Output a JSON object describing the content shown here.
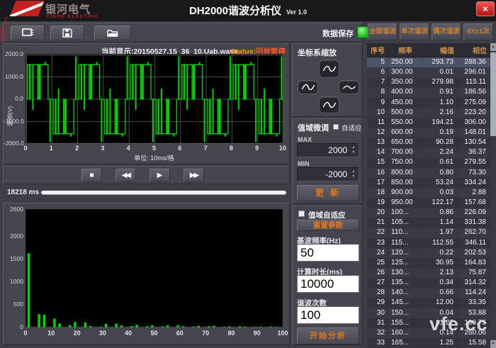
{
  "header": {
    "logo_cn": "银河电气",
    "logo_en": "YINHE ELECTRIC",
    "logo_vertical": "YINHE ELECTRIC",
    "title": "DH2000谐波分析仪",
    "version": "Ver 1.0",
    "close": "×"
  },
  "toolbar": {
    "save_label": "数据保存"
  },
  "wave_panel": {
    "current_label": "当前显示:20150527.15_36_10.Uab.wave",
    "status_key": "Status:",
    "status_value": "回放暂停",
    "y_axis_label": "幅值(V)",
    "unit_label": "单位: 10ms/格",
    "y_tick_labels": [
      "2000.0",
      "1000.0",
      "0.0",
      "-1000.0",
      "-2000.0"
    ],
    "x_tick_labels": [
      "0",
      "1",
      "2",
      "3",
      "4",
      "5",
      "6",
      "7",
      "8",
      "9",
      "10"
    ]
  },
  "playback": {
    "stop": "■",
    "rewind": "◀◀",
    "play": "▶",
    "forward": "▶▶",
    "time_label": "18218 ms"
  },
  "spectrum_panel": {
    "y_tick_labels": [
      "2600",
      "2000",
      "1500",
      "1000",
      "500",
      "0"
    ],
    "y_tick_values": [
      2600,
      2000,
      1500,
      1000,
      500,
      0
    ],
    "x_tick_labels": [
      "0",
      "10",
      "20",
      "30",
      "40",
      "50",
      "60",
      "70",
      "80",
      "90",
      "100"
    ]
  },
  "zoom_panel": {
    "title": "坐标系缩放"
  },
  "range_panel": {
    "title": "值域微调",
    "auto_label": "自适应",
    "max_label": "MAX",
    "max_value": "2000",
    "min_label": "MIN",
    "min_value": "-2000",
    "update_label": "更 新"
  },
  "analysis_panel": {
    "auto_label": "值域自适应",
    "reset_label": "重置参数",
    "freq_label": "基波频率(Hz)",
    "freq_value": "50",
    "duration_label": "计算时长(ms)",
    "duration_value": "10000",
    "count_label": "谐波次数",
    "count_value": "100",
    "start_label": "开始分析"
  },
  "tabs": [
    {
      "label": "全部谐波"
    },
    {
      "label": "单次谐波"
    },
    {
      "label": "偶次谐波"
    },
    {
      "label": "6X±1次"
    }
  ],
  "table": {
    "headers": [
      "序号",
      "频率",
      "幅值",
      "相位"
    ],
    "selected_index": 0,
    "rows": [
      [
        "5",
        "250.00",
        "293.73",
        "288.36"
      ],
      [
        "6",
        "300.00",
        "0.01",
        "296.01"
      ],
      [
        "7",
        "350.00",
        "279.98",
        "115.11"
      ],
      [
        "8",
        "400.00",
        "0.91",
        "186.56"
      ],
      [
        "9",
        "450.00",
        "1.10",
        "275.09"
      ],
      [
        "10",
        "500.00",
        "2.16",
        "223.20"
      ],
      [
        "11",
        "550.00",
        "194.21",
        "306.00"
      ],
      [
        "12",
        "600.00",
        "0.19",
        "148.01"
      ],
      [
        "13",
        "650.00",
        "90.28",
        "130.54"
      ],
      [
        "14",
        "700.00",
        "2.24",
        "36.37"
      ],
      [
        "15",
        "750.00",
        "0.61",
        "279.55"
      ],
      [
        "16",
        "800.00",
        "0.80",
        "73.30"
      ],
      [
        "17",
        "850.00",
        "53.24",
        "334.24"
      ],
      [
        "18",
        "900.00",
        "0.03",
        "2.88"
      ],
      [
        "19",
        "950.00",
        "122.17",
        "157.68"
      ],
      [
        "20",
        "100...",
        "0.86",
        "226.09"
      ],
      [
        "21",
        "105...",
        "1.14",
        "331.38"
      ],
      [
        "22",
        "110...",
        "1.97",
        "262.70"
      ],
      [
        "23",
        "115...",
        "112.55",
        "346.11"
      ],
      [
        "24",
        "120...",
        "0.22",
        "202.53"
      ],
      [
        "25",
        "125...",
        "30.95",
        "164.83"
      ],
      [
        "26",
        "130...",
        "2.13",
        "75.87"
      ],
      [
        "27",
        "135...",
        "0.34",
        "314.32"
      ],
      [
        "28",
        "140...",
        "0.66",
        "114.24"
      ],
      [
        "29",
        "145...",
        "12.00",
        "33.35"
      ],
      [
        "30",
        "150...",
        "0.04",
        "53.88"
      ],
      [
        "31",
        "155...",
        "81.22",
        "199.75"
      ],
      [
        "32",
        "160...",
        "0.14",
        "260.06"
      ],
      [
        "33",
        "165...",
        "1.25",
        "15.58"
      ]
    ]
  },
  "watermark": "vfe.cc",
  "colors": {
    "trace_green": "#00d400",
    "accent_orange": "#e67817",
    "status_orange": "#ff9900",
    "status_red": "#ff5522",
    "led_green": "#22c322"
  },
  "chart_data": [
    {
      "type": "line",
      "name": "pwm-line-voltage-waveform",
      "x_unit": "10ms/div",
      "x_range_ms": [
        0,
        100
      ],
      "y_range": [
        -2000,
        2000
      ],
      "grid_y_values": [
        1000,
        0,
        -1000
      ],
      "period_ms": 20,
      "periods": 5,
      "pattern": [
        [
          0,
          0
        ],
        [
          0.5,
          0
        ],
        [
          0.5,
          1550
        ],
        [
          1.3,
          1550
        ],
        [
          1.3,
          0
        ],
        [
          1.6,
          0
        ],
        [
          1.6,
          1550
        ],
        [
          2.5,
          1550
        ],
        [
          2.5,
          -450
        ],
        [
          2.7,
          -450
        ],
        [
          2.7,
          1550
        ],
        [
          4.5,
          1550
        ],
        [
          4.5,
          0
        ],
        [
          4.9,
          0
        ],
        [
          4.9,
          1550
        ],
        [
          5.2,
          1550
        ],
        [
          5.2,
          0
        ],
        [
          5.5,
          0
        ],
        [
          5.5,
          1550
        ],
        [
          7.3,
          1550
        ],
        [
          7.3,
          1650
        ],
        [
          7.5,
          1650
        ],
        [
          7.5,
          1550
        ],
        [
          8.5,
          1550
        ],
        [
          8.5,
          0
        ],
        [
          9.2,
          0
        ],
        [
          9.2,
          -1900
        ],
        [
          9.4,
          -1900
        ],
        [
          9.4,
          0
        ],
        [
          10,
          0
        ],
        [
          10.5,
          0
        ],
        [
          10.5,
          -1550
        ],
        [
          11.3,
          -1550
        ],
        [
          11.3,
          0
        ],
        [
          11.6,
          0
        ],
        [
          11.6,
          -1550
        ],
        [
          12.5,
          -1550
        ],
        [
          12.5,
          450
        ],
        [
          12.7,
          450
        ],
        [
          12.7,
          -1550
        ],
        [
          14.5,
          -1550
        ],
        [
          14.5,
          0
        ],
        [
          14.9,
          0
        ],
        [
          14.9,
          -1550
        ],
        [
          15.2,
          -1550
        ],
        [
          15.2,
          0
        ],
        [
          15.5,
          0
        ],
        [
          15.5,
          -1550
        ],
        [
          17.3,
          -1550
        ],
        [
          17.3,
          -1650
        ],
        [
          17.5,
          -1650
        ],
        [
          17.5,
          -1550
        ],
        [
          18.5,
          -1550
        ],
        [
          18.5,
          0
        ],
        [
          19.2,
          0
        ],
        [
          19.2,
          1900
        ],
        [
          19.4,
          1900
        ],
        [
          19.4,
          0
        ],
        [
          20,
          0
        ]
      ]
    },
    {
      "type": "bar",
      "name": "harmonic-spectrum",
      "x_range": [
        0,
        100
      ],
      "y_range": [
        0,
        2600
      ],
      "bars": [
        [
          1,
          1640
        ],
        [
          5,
          294
        ],
        [
          7,
          280
        ],
        [
          11,
          194
        ],
        [
          13,
          90
        ],
        [
          17,
          53
        ],
        [
          19,
          122
        ],
        [
          23,
          113
        ],
        [
          25,
          31
        ],
        [
          29,
          12
        ],
        [
          31,
          81
        ],
        [
          35,
          85
        ],
        [
          37,
          44
        ],
        [
          41,
          30
        ],
        [
          43,
          58
        ],
        [
          47,
          26
        ],
        [
          49,
          50
        ],
        [
          53,
          20
        ],
        [
          55,
          46
        ],
        [
          59,
          52
        ],
        [
          61,
          28
        ],
        [
          65,
          16
        ],
        [
          67,
          34
        ],
        [
          71,
          26
        ],
        [
          73,
          40
        ],
        [
          77,
          12
        ],
        [
          79,
          22
        ],
        [
          83,
          26
        ],
        [
          85,
          16
        ],
        [
          89,
          10
        ],
        [
          91,
          14
        ],
        [
          95,
          20
        ],
        [
          97,
          8
        ]
      ]
    }
  ]
}
